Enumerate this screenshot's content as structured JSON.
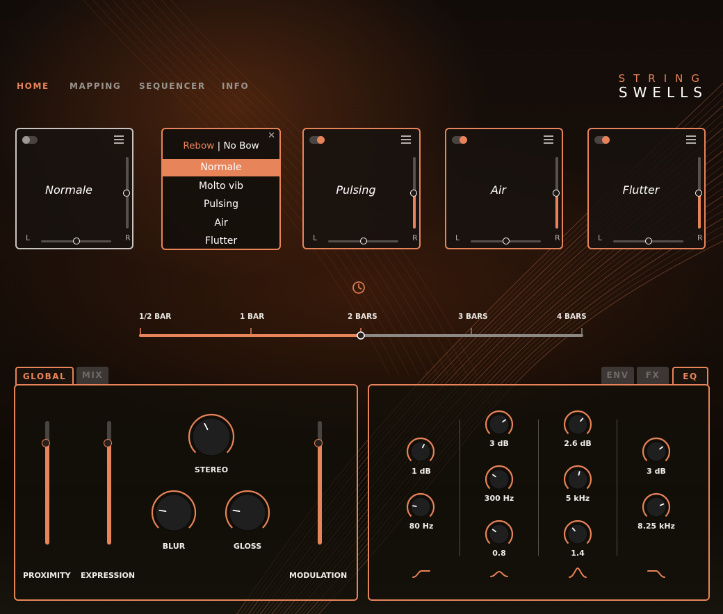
{
  "colors": {
    "accent": "#e8845a",
    "inactive": "#57514c",
    "card_selected_border": "#c9c4c0"
  },
  "nav": [
    "HOME",
    "MAPPING",
    "SEQUENCER",
    "INFO"
  ],
  "active_nav": "HOME",
  "logo": {
    "line1": "STRING",
    "line2": "SWELLS"
  },
  "cards": [
    {
      "title": "Normale",
      "enabled": false,
      "selected": true,
      "level": 0.5,
      "pan_left": "L",
      "pan_right": "R",
      "pan": 0.5
    },
    {
      "title": "Pulsing",
      "enabled": true,
      "selected": false,
      "level": 0.5,
      "pan_left": "L",
      "pan_right": "R",
      "pan": 0.5
    },
    {
      "title": "Air",
      "enabled": true,
      "selected": false,
      "level": 0.5,
      "pan_left": "L",
      "pan_right": "R",
      "pan": 0.5
    },
    {
      "title": "Flutter",
      "enabled": true,
      "selected": false,
      "level": 0.5,
      "pan_left": "L",
      "pan_right": "R",
      "pan": 0.5
    }
  ],
  "articulation_menu": {
    "rebow": "Rebow",
    "separator": "|",
    "nobow": "No Bow",
    "options": [
      "Normale",
      "Molto vib",
      "Pulsing",
      "Air",
      "Flutter"
    ],
    "selected": "Normale"
  },
  "timeline": {
    "icon": "clock-icon",
    "labels": [
      "1/2 BAR",
      "1 BAR",
      "2 BARS",
      "3 BARS",
      "4 BARS"
    ],
    "value": "2 BARS"
  },
  "left_tabs": [
    "GLOBAL",
    "MIX"
  ],
  "left_active_tab": "GLOBAL",
  "right_tabs": [
    "ENV",
    "FX",
    "EQ"
  ],
  "right_active_tab": "EQ",
  "global": {
    "faders": [
      {
        "label": "PROXIMITY",
        "value": 0.82
      },
      {
        "label": "EXPRESSION",
        "value": 0.82
      },
      {
        "label": "MODULATION",
        "value": 0.82
      }
    ],
    "knobs": [
      {
        "label": "STEREO",
        "value": 0.4
      },
      {
        "label": "BLUR",
        "value": 0.2
      },
      {
        "label": "GLOSS",
        "value": 0.2
      }
    ]
  },
  "eq": {
    "bands": [
      {
        "filter_icon": "low-shelf-icon",
        "knobs": [
          {
            "label": "1 dB",
            "value": 0.6
          },
          {
            "label": "80 Hz",
            "value": 0.2
          }
        ]
      },
      {
        "filter_icon": "bell-icon",
        "knobs": [
          {
            "label": "3 dB",
            "value": 0.7
          },
          {
            "label": "300 Hz",
            "value": 0.3
          },
          {
            "label": "0.8",
            "value": 0.3
          }
        ]
      },
      {
        "filter_icon": "peak-icon",
        "knobs": [
          {
            "label": "2.6 dB",
            "value": 0.65
          },
          {
            "label": "5 kHz",
            "value": 0.55
          },
          {
            "label": "1.4",
            "value": 0.35
          }
        ]
      },
      {
        "filter_icon": "high-shelf-icon",
        "knobs": [
          {
            "label": "3 dB",
            "value": 0.7
          },
          {
            "label": "8.25 kHz",
            "value": 0.75
          }
        ]
      }
    ]
  }
}
